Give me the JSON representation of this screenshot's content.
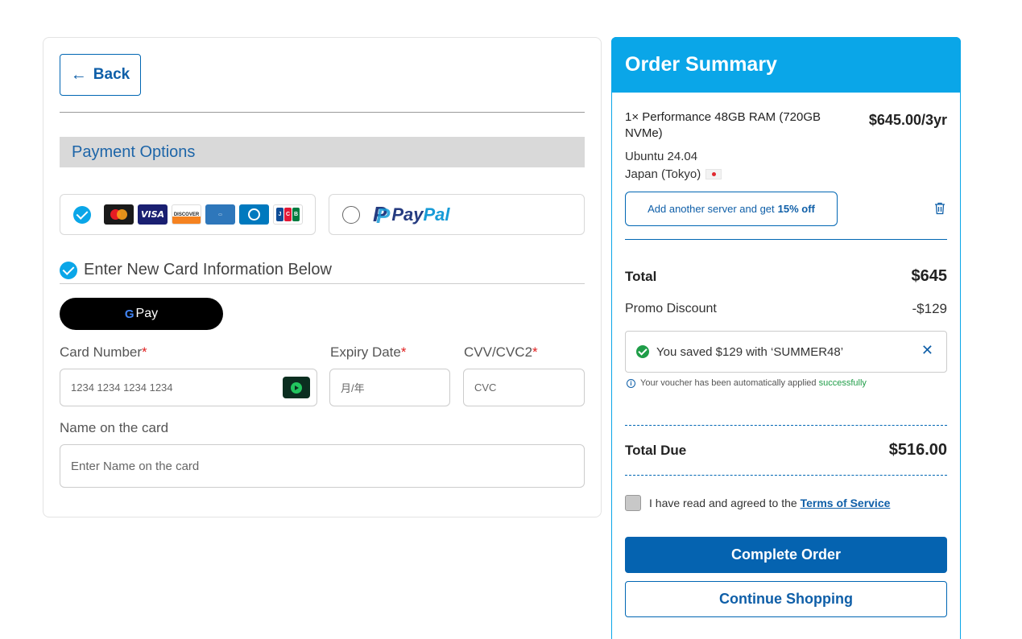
{
  "payment": {
    "back_label": "Back",
    "section_title": "Payment Options",
    "paypal_pay": "Pay",
    "paypal_pal": "Pal",
    "new_card_label": "Enter New Card Information Below",
    "gpay_g": "G",
    "gpay_label": "Pay",
    "card_number_label": "Card Number",
    "card_number_placeholder": "1234 1234 1234 1234",
    "expiry_label": "Expiry Date",
    "expiry_placeholder": "月/年",
    "cvv_label": "CVV/CVC2",
    "cvv_placeholder": "CVC",
    "name_label": "Name on the card",
    "name_placeholder": "Enter Name on the card",
    "required_mark": "*",
    "card_brands": [
      "mastercard-icon",
      "visa-icon",
      "discover-icon",
      "amex-icon",
      "diners-icon",
      "jcb-icon"
    ],
    "visa_text": "VISA",
    "discover_text": "DISCOVER"
  },
  "summary": {
    "title": "Order Summary",
    "item_name": "1× Performance 48GB RAM (720GB NVMe)",
    "item_price": "$645.00/3yr",
    "item_os": "Ubuntu 24.04",
    "item_location": "Japan (Tokyo)",
    "add_server_text": "Add another server and get",
    "add_server_bold": "15% off",
    "total_label": "Total",
    "total_value": "$645",
    "promo_label": "Promo Discount",
    "promo_value": "-$129",
    "voucher_text": "You saved $129 with ‘SUMMER48’",
    "voucher_note": "Your voucher has been automatically applied",
    "voucher_note_success": "successfully",
    "total_due_label": "Total Due",
    "total_due_value": "$516.00",
    "terms_text": "I have read and agreed to the",
    "terms_link": "Terms of Service",
    "complete_label": "Complete Order",
    "continue_label": "Continue Shopping"
  },
  "colors": {
    "accent": "#0aa6e8",
    "primary": "#0563b0",
    "success": "#1f9d48",
    "required": "#e02020"
  }
}
